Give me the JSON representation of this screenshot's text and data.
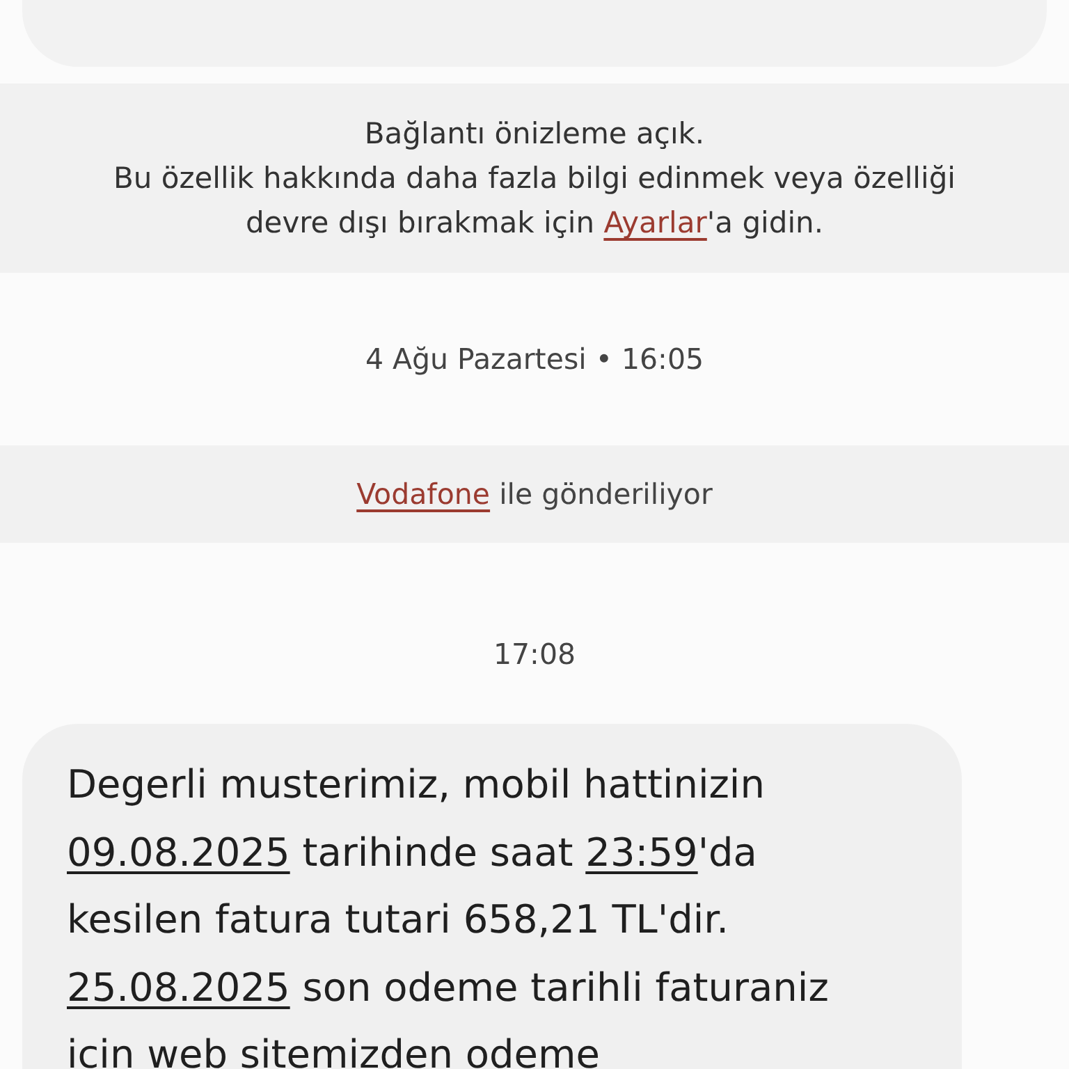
{
  "link_preview_notice": {
    "lines": [
      [
        {
          "text": "Bağlantı önizleme açık.",
          "kind": "text"
        }
      ],
      [
        {
          "text": "Bu özellik hakkında daha fazla bilgi edinmek veya özelliği",
          "kind": "text"
        }
      ],
      [
        {
          "text": "devre dışı bırakmak için ",
          "kind": "text"
        },
        {
          "text": "Ayarlar",
          "kind": "link"
        },
        {
          "text": "'a gidin.",
          "kind": "text"
        }
      ]
    ]
  },
  "date_header": "4 Ağu Pazartesi • 16:05",
  "sender_notice": [
    {
      "text": "Vodafone",
      "kind": "link"
    },
    {
      "text": " ile gönderiliyor",
      "kind": "text"
    }
  ],
  "message_time": "17:08",
  "message": {
    "lines": [
      [
        {
          "text": "Degerli musterimiz, mobil hattinizin",
          "kind": "text"
        }
      ],
      [
        {
          "text": "09.08.2025",
          "kind": "link"
        },
        {
          "text": " tarihinde saat ",
          "kind": "text"
        },
        {
          "text": "23:59",
          "kind": "link"
        },
        {
          "text": "'da",
          "kind": "text"
        }
      ],
      [
        {
          "text": "kesilen fatura tutari 658,21 TL'dir.",
          "kind": "text"
        }
      ],
      [
        {
          "text": "25.08.2025",
          "kind": "link"
        },
        {
          "text": " son odeme tarihli faturaniz",
          "kind": "text"
        }
      ],
      [
        {
          "text": "icin web sitemizden odeme",
          "kind": "text"
        }
      ]
    ]
  }
}
